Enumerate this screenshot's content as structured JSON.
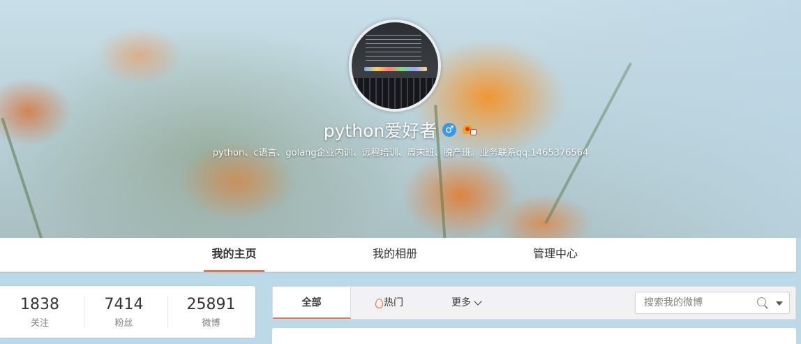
{
  "profile": {
    "nickname": "python爱好者",
    "gender_icon_glyph": "♂",
    "bio": "python、c语言、golang企业内训、远程培训、周末班、脱产班。业务联系qq:1465376564"
  },
  "nav": {
    "tabs": [
      {
        "label": "我的主页",
        "active": true
      },
      {
        "label": "我的相册",
        "active": false
      },
      {
        "label": "管理中心",
        "active": false
      }
    ]
  },
  "counters": [
    {
      "value": "1838",
      "label": "关注"
    },
    {
      "value": "7414",
      "label": "粉丝"
    },
    {
      "value": "25891",
      "label": "微博"
    }
  ],
  "feed_filter": {
    "all_label": "全部",
    "hot_label": "热门",
    "more_label": "更多",
    "search_placeholder": "搜索我的微博"
  },
  "colors": {
    "accent": "#eb7350",
    "gender_badge": "#3a98e6"
  }
}
